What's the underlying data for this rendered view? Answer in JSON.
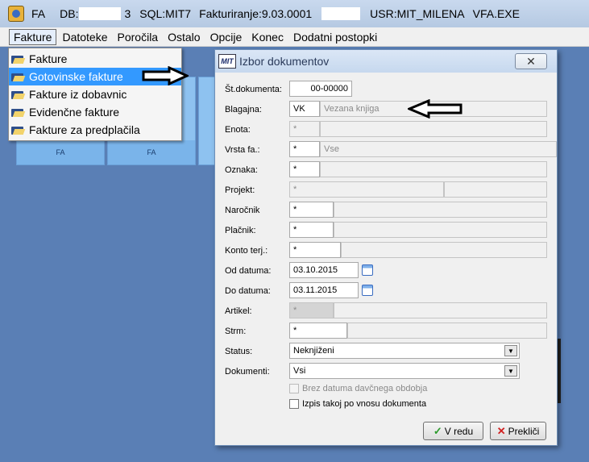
{
  "titlebar": {
    "app_code": "FA",
    "db_label": "DB:",
    "db_suffix": "3",
    "sql": "SQL:MIT7",
    "module": "Fakturiranje:9.03.0001",
    "user": "USR:MIT_MILENA",
    "exe": "VFA.EXE"
  },
  "menubar": {
    "items": [
      "Fakture",
      "Datoteke",
      "Poročila",
      "Ostalo",
      "Opcije",
      "Konec",
      "Dodatni postopki"
    ]
  },
  "dropdown": {
    "items": [
      "Fakture",
      "Gotovinske fakture",
      "Fakture iz dobavnic",
      "Evidenčne fakture",
      "Fakture za predplačila"
    ]
  },
  "tiles": [
    "FA",
    "FA"
  ],
  "dialog": {
    "logo": "MIT",
    "title": "Izbor dokumentov",
    "fields": {
      "st_dokumenta": {
        "label": "Št.dokumenta:",
        "value": "00-00000"
      },
      "blagajna": {
        "label": "Blagajna:",
        "code": "VK",
        "desc": "Vezana knjiga"
      },
      "enota": {
        "label": "Enota:",
        "code": "*"
      },
      "vrsta": {
        "label": "Vrsta fa.:",
        "code": "*",
        "desc": "Vse"
      },
      "oznaka": {
        "label": "Oznaka:",
        "code": "*"
      },
      "projekt": {
        "label": "Projekt:",
        "code": "*"
      },
      "narocnik": {
        "label": "Naročnik",
        "code": "*"
      },
      "placnik": {
        "label": "Plačnik:",
        "code": "*"
      },
      "konto": {
        "label": "Konto terj.:",
        "code": "*"
      },
      "od_datuma": {
        "label": "Od datuma:",
        "value": "03.10.2015"
      },
      "do_datuma": {
        "label": "Do datuma:",
        "value": "03.11.2015"
      },
      "artikel": {
        "label": "Artikel:",
        "code": "*"
      },
      "strm": {
        "label": "Strm:",
        "code": "*"
      },
      "status": {
        "label": "Status:",
        "value": "Neknjiženi"
      },
      "dokumenti": {
        "label": "Dokumenti:",
        "value": "Vsi"
      }
    },
    "checkbox_brez": "Brez datuma davčnega obdobja",
    "checkbox_izpis": "Izpis takoj po vnosu dokumenta",
    "ok_label": "V redu",
    "cancel_label": "Prekliči"
  }
}
